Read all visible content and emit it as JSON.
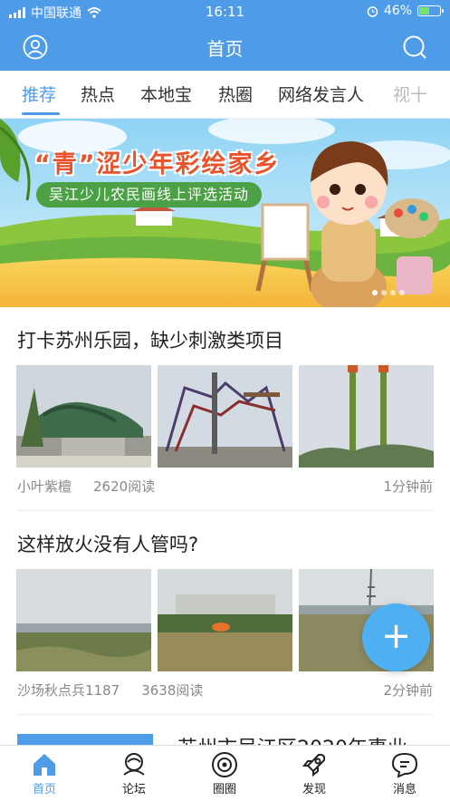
{
  "status": {
    "carrier": "中国联通",
    "time": "16:11",
    "battery": "46%"
  },
  "nav": {
    "title": "首页"
  },
  "tabs": [
    {
      "label": "推荐",
      "active": true
    },
    {
      "label": "热点"
    },
    {
      "label": "本地宝"
    },
    {
      "label": "热圈"
    },
    {
      "label": "网络发言人"
    },
    {
      "label": "视十"
    }
  ],
  "banner": {
    "title": "“青”涩少年彩绘家乡",
    "subtitle": "吴江少儿农民画线上评选活动"
  },
  "posts": [
    {
      "title": "打卡苏州乐园，缺少刺激类项目",
      "author": "小叶紫檀",
      "reads": "2620阅读",
      "time": "1分钟前"
    },
    {
      "title": "这样放火没有人管吗?",
      "author": "沙场秋点兵1187",
      "reads": "3638阅读",
      "time": "2分钟前"
    },
    {
      "title": "苏州市吴江区2020年事业"
    }
  ],
  "bottom_nav": [
    {
      "label": "首页",
      "icon": "home-icon",
      "active": true
    },
    {
      "label": "论坛",
      "icon": "forum-icon"
    },
    {
      "label": "圈圈",
      "icon": "circle-icon"
    },
    {
      "label": "发现",
      "icon": "rocket-icon"
    },
    {
      "label": "消息",
      "icon": "message-icon"
    }
  ],
  "colors": {
    "brand": "#4e9ce8",
    "fab": "#4eb0f0"
  }
}
